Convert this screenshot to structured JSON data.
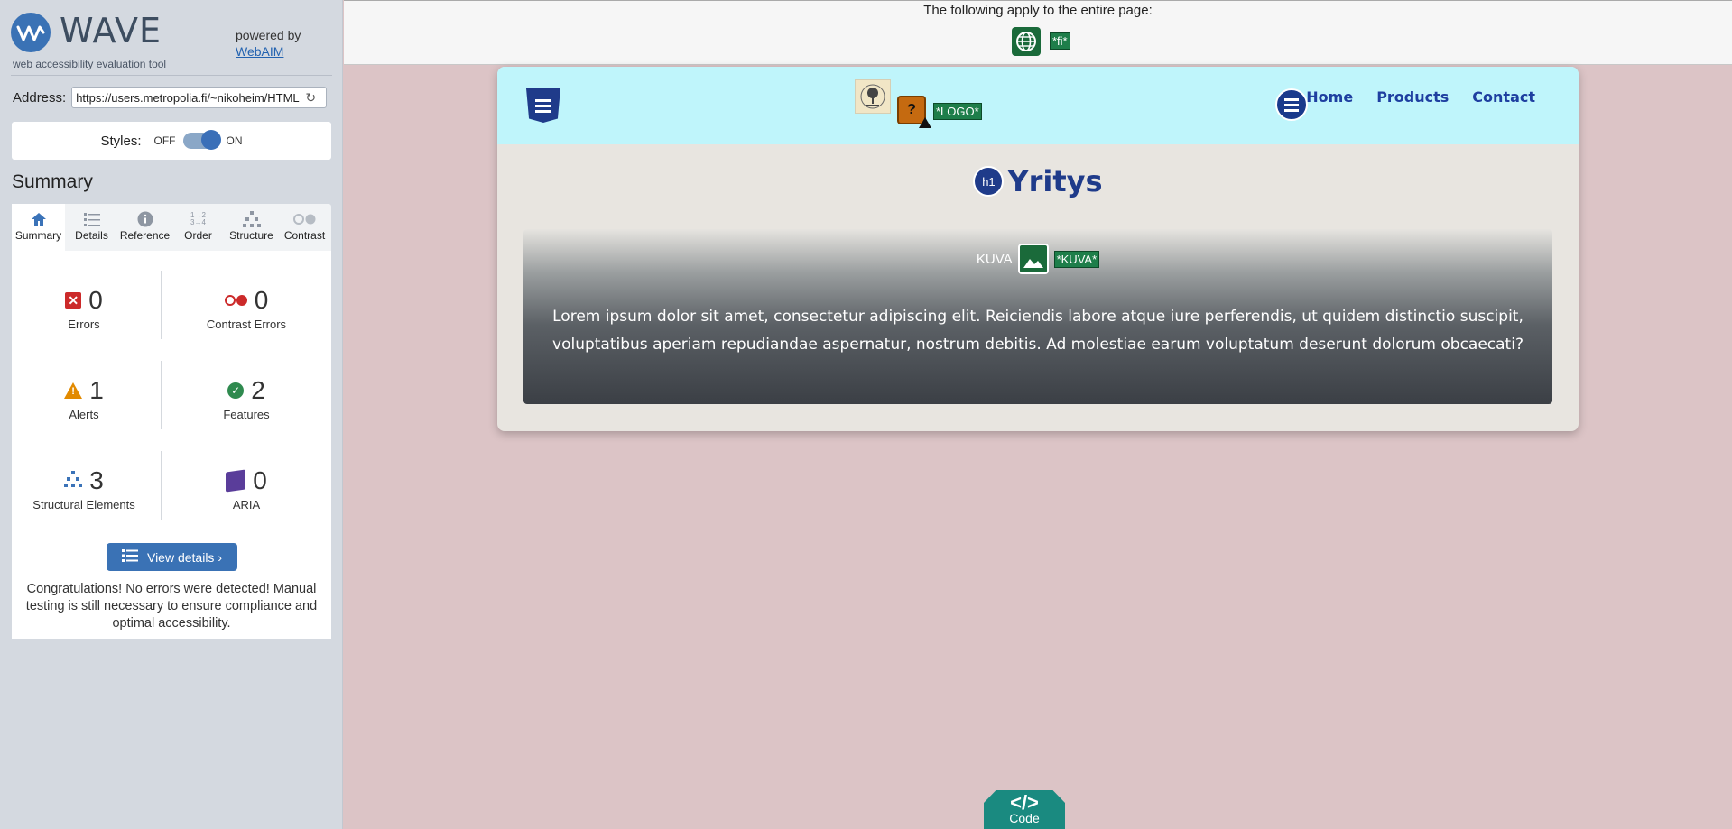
{
  "sidebar": {
    "app_title": "WAVE",
    "app_subtitle": "web accessibility evaluation tool",
    "powered_by": "powered by",
    "webaim_link": "WebAIM",
    "address_label": "Address:",
    "address_value": "https://users.metropolia.fi/~nikoheim/HTML",
    "styles_label": "Styles:",
    "styles_off": "OFF",
    "styles_on": "ON",
    "summary_title": "Summary",
    "tabs": [
      {
        "label": "Summary",
        "icon": "home-icon"
      },
      {
        "label": "Details",
        "icon": "list-icon"
      },
      {
        "label": "Reference",
        "icon": "info-icon"
      },
      {
        "label": "Order",
        "icon": "order-icon"
      },
      {
        "label": "Structure",
        "icon": "structure-icon"
      },
      {
        "label": "Contrast",
        "icon": "contrast-icon"
      }
    ],
    "stats": {
      "errors": {
        "count": "0",
        "label": "Errors"
      },
      "contrast_errors": {
        "count": "0",
        "label": "Contrast Errors"
      },
      "alerts": {
        "count": "1",
        "label": "Alerts"
      },
      "features": {
        "count": "2",
        "label": "Features"
      },
      "structural": {
        "count": "3",
        "label": "Structural Elements"
      },
      "aria": {
        "count": "0",
        "label": "ARIA"
      }
    },
    "view_details": "View details ›",
    "congrats": "Congratulations! No errors were detected! Manual testing is still necessary to ensure compliance and optimal accessibility."
  },
  "notice": {
    "text": "The following apply to the entire page:",
    "lang_tag": "*fi*"
  },
  "page": {
    "logo_tag": "*LOGO*",
    "nav": [
      "Home",
      "Products",
      "Contact"
    ],
    "h1_badge": "h1",
    "heading": "Yritys",
    "image_alt": "KUVA",
    "image_tag": "*KUVA*",
    "paragraph": "Lorem ipsum dolor sit amet, consectetur adipiscing elit. Reiciendis labore atque iure perferendis, ut quidem distinctio suscipit, voluptatibus aperiam repudiandae aspernatur, nostrum debitis. Ad molestiae earum voluptatum deserunt dolorum obcaecati?",
    "code_symbol": "</>",
    "code_label": "Code"
  },
  "colors": {
    "wave_blue": "#3a72b5",
    "error_red": "#cc2a2a",
    "alert_orange": "#e28a00",
    "feature_green": "#2f8a4f",
    "aria_purple": "#5a3d9a",
    "header_cyan": "#bff5fb",
    "page_bg": "#dcc4c6"
  }
}
